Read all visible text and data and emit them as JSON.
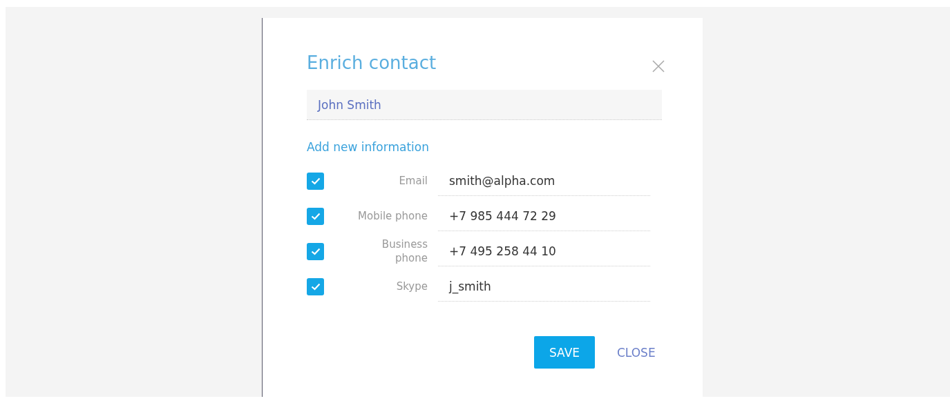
{
  "dialog": {
    "title": "Enrich contact",
    "contact_name": "John Smith",
    "section_title": "Add new information",
    "fields": [
      {
        "label": "Email",
        "value": "smith@alpha.com",
        "checked": true
      },
      {
        "label": "Mobile phone",
        "value": "+7 985 444 72 29",
        "checked": true
      },
      {
        "label": "Business phone",
        "value": "+7 495 258 44 10",
        "checked": true
      },
      {
        "label": "Skype",
        "value": "j_smith",
        "checked": true
      }
    ],
    "buttons": [
      {
        "label": "SAVE",
        "kind": "primary"
      },
      {
        "label": "CLOSE",
        "kind": "link"
      }
    ]
  }
}
